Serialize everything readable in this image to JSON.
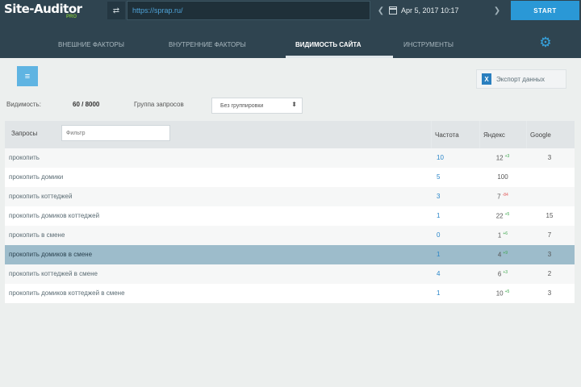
{
  "header": {
    "logo": "Site-Auditor",
    "logo_sub": "PRO",
    "url_value": "https://sprap.ru/",
    "date": "Apr 5, 2017 10:17",
    "start_label": "START"
  },
  "nav": {
    "tabs": [
      {
        "label": "ВНЕШНИЕ ФАКТОРЫ"
      },
      {
        "label": "ВНУТРЕННИЕ ФАКТОРЫ"
      },
      {
        "label": "ВИДИМОСТЬ САЙТА"
      },
      {
        "label": "ИНСТРУМЕНТЫ"
      }
    ],
    "active_tab": 2
  },
  "toolbar": {
    "export_label": "Экспорт данных"
  },
  "filters": {
    "visibility_label": "Видимость:",
    "visibility_value": "60 / 8000",
    "group_label": "Группа запросов",
    "group_value": "Без группировки"
  },
  "table": {
    "query_header": "Запросы",
    "filter_placeholder": "Фильтр",
    "freq_header": "Частота",
    "yandex_header": "Яндекс",
    "google_header": "Google",
    "rows": [
      {
        "query": "прокопить",
        "freq": "10",
        "yandex": "12",
        "ydelta": "+3",
        "ydir": "up",
        "google": "3"
      },
      {
        "query": "прокопить домики",
        "freq": "5",
        "yandex": "100",
        "ydelta": "",
        "ydir": "",
        "google": ""
      },
      {
        "query": "прокопить коттеджей",
        "freq": "3",
        "yandex": "7",
        "ydelta": "-84",
        "ydir": "down",
        "google": ""
      },
      {
        "query": "прокопить домиков коттеджей",
        "freq": "1",
        "yandex": "22",
        "ydelta": "+5",
        "ydir": "up",
        "google": "15"
      },
      {
        "query": "прокопить в смене",
        "freq": "0",
        "yandex": "1",
        "ydelta": "+6",
        "ydir": "up",
        "google": "7"
      },
      {
        "query": "прокопить домиков в смене",
        "freq": "1",
        "yandex": "4",
        "ydelta": "+9",
        "ydir": "up",
        "google": "3"
      },
      {
        "query": "прокопить коттеджей в смене",
        "freq": "4",
        "yandex": "6",
        "ydelta": "+3",
        "ydir": "up",
        "google": "2"
      },
      {
        "query": "прокопить домиков коттеджей в смене",
        "freq": "1",
        "yandex": "10",
        "ydelta": "+5",
        "ydir": "up",
        "google": "3"
      }
    ],
    "selected_row": 5
  },
  "colors": {
    "topbar": "#2f4450",
    "accent": "#2a98d6",
    "selected_row": "#9dbccb"
  },
  "icons": {
    "url_button": "link-icon",
    "calendar": "calendar-icon",
    "settings": "gear-icon",
    "menu": "menu-icon",
    "export": "excel-icon"
  }
}
